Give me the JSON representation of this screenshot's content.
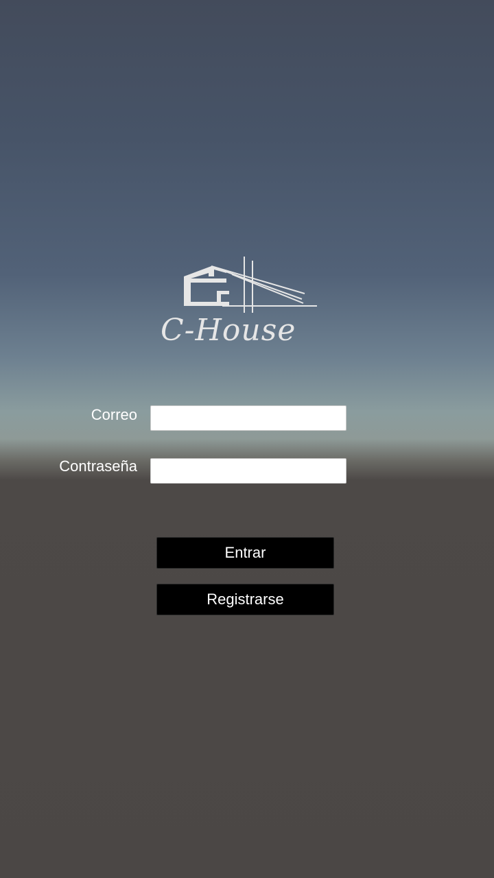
{
  "logo": {
    "text": "C-House",
    "icon": "house-logo-icon",
    "color": "#e6e6e6"
  },
  "form": {
    "email_label": "Correo",
    "email_value": "",
    "password_label": "Contraseña",
    "password_value": ""
  },
  "buttons": {
    "login_label": "Entrar",
    "register_label": "Registrarse"
  },
  "colors": {
    "sky_top": "#434b5b",
    "horizon": "#8e9a97",
    "ground": "#4b4745",
    "button_bg": "#000000",
    "button_text": "#ffffff"
  }
}
